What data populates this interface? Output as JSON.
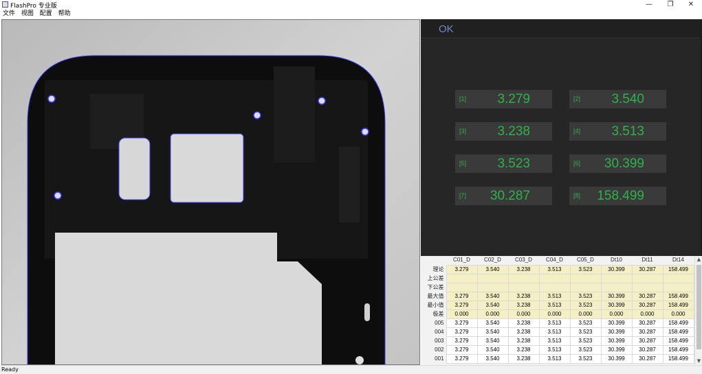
{
  "app": {
    "title": "FlashPro 专业版"
  },
  "window_controls": {
    "minimize": "—",
    "restore": "❐",
    "close": "✕"
  },
  "menu": [
    "文件",
    "视图",
    "配置",
    "帮助"
  ],
  "status_panel": {
    "result": "OK",
    "result_color": "#7b86c6"
  },
  "measurements": [
    {
      "index": "[1]",
      "value": "3.279"
    },
    {
      "index": "[2]",
      "value": "3.540"
    },
    {
      "index": "[3]",
      "value": "3.238"
    },
    {
      "index": "[4]",
      "value": "3.513"
    },
    {
      "index": "[5]",
      "value": "3.523"
    },
    {
      "index": "[6]",
      "value": "30.399"
    },
    {
      "index": "[7]",
      "value": "30.287"
    },
    {
      "index": "[8]",
      "value": "158.499"
    }
  ],
  "measurement_color": "#2eb24a",
  "table": {
    "columns": [
      "C01_D",
      "C02_D",
      "C03_D",
      "C04_D",
      "C05_D",
      "Dt10",
      "Dt11",
      "Dt14"
    ],
    "rows": [
      {
        "label": "理论",
        "values": [
          "3.279",
          "3.540",
          "3.238",
          "3.513",
          "3.523",
          "30.399",
          "30.287",
          "158.499"
        ],
        "style": "hl"
      },
      {
        "label": "上公差",
        "values": [
          "",
          "",
          "",
          "",
          "",
          "",
          "",
          ""
        ],
        "style": "hl"
      },
      {
        "label": "下公差",
        "values": [
          "",
          "",
          "",
          "",
          "",
          "",
          "",
          ""
        ],
        "style": "hl"
      },
      {
        "label": "最大值",
        "values": [
          "3.279",
          "3.540",
          "3.238",
          "3.513",
          "3.523",
          "30.399",
          "30.287",
          "158.499"
        ],
        "style": "hl"
      },
      {
        "label": "最小值",
        "values": [
          "3.279",
          "3.540",
          "3.238",
          "3.513",
          "3.523",
          "30.399",
          "30.287",
          "158.499"
        ],
        "style": "hl"
      },
      {
        "label": "极差",
        "values": [
          "0.000",
          "0.000",
          "0.000",
          "0.000",
          "0.000",
          "0.000",
          "0.000",
          "0.000"
        ],
        "style": "hl"
      },
      {
        "label": "005",
        "values": [
          "3.279",
          "3.540",
          "3.238",
          "3.513",
          "3.523",
          "30.399",
          "30.287",
          "158.499"
        ],
        "style": "wt"
      },
      {
        "label": "004",
        "values": [
          "3.279",
          "3.540",
          "3.238",
          "3.513",
          "3.523",
          "30.399",
          "30.287",
          "158.499"
        ],
        "style": "wt"
      },
      {
        "label": "003",
        "values": [
          "3.279",
          "3.540",
          "3.238",
          "3.513",
          "3.523",
          "30.399",
          "30.287",
          "158.499"
        ],
        "style": "wt"
      },
      {
        "label": "002",
        "values": [
          "3.279",
          "3.540",
          "3.238",
          "3.513",
          "3.523",
          "30.399",
          "30.287",
          "158.499"
        ],
        "style": "wt"
      },
      {
        "label": "001",
        "values": [
          "3.279",
          "3.540",
          "3.238",
          "3.513",
          "3.523",
          "30.399",
          "30.287",
          "158.499"
        ],
        "style": "wt"
      }
    ]
  },
  "statusbar": {
    "text": "Ready"
  }
}
